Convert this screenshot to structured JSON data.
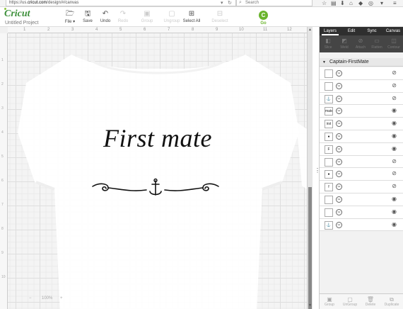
{
  "browser": {
    "url_prefix": "https://us.",
    "url_host": "cricut.com",
    "url_path": "/design/#/canvas",
    "search_placeholder": "Search"
  },
  "app": {
    "logo": "Cricut",
    "project_name": "Untitled Project",
    "accent": "#6ab42d",
    "go_label": "Go"
  },
  "toolbar": {
    "file": "File ▾",
    "save": "Save",
    "undo": "Undo",
    "redo": "Redo",
    "group": "Group",
    "ungroup": "Ungroup",
    "select_all": "Select All",
    "deselect": "Deselect"
  },
  "ruler": {
    "top": [
      "1",
      "2",
      "3",
      "4",
      "5",
      "6",
      "7",
      "8",
      "9",
      "10",
      "11",
      "12"
    ],
    "left": [
      "1",
      "2",
      "3",
      "4",
      "5",
      "6",
      "7",
      "8",
      "9",
      "10"
    ]
  },
  "design": {
    "title": "First mate"
  },
  "zoom": {
    "minus": "−",
    "value": "100%",
    "plus": "+"
  },
  "panel": {
    "tabs": [
      "Layers",
      "Edit",
      "Sync",
      "Canvas"
    ],
    "tools": [
      "Slice",
      "Weld",
      "Attach",
      "Flatten",
      "Contour"
    ],
    "group_name": "Captain-FirstMate",
    "layers": [
      {
        "thumb": "",
        "visible": "hidden"
      },
      {
        "thumb": "",
        "visible": "hidden"
      },
      {
        "thumb": "⚓",
        "visible": "hidden"
      },
      {
        "thumb": "mate",
        "visible": "visible"
      },
      {
        "thumb": "irst",
        "visible": "visible"
      },
      {
        "thumb": "●",
        "visible": "visible"
      },
      {
        "thumb": "F",
        "visible": "visible"
      },
      {
        "thumb": "",
        "visible": "hidden"
      },
      {
        "thumb": "●",
        "visible": "hidden"
      },
      {
        "thumb": "f",
        "visible": "hidden"
      },
      {
        "thumb": "",
        "visible": "visible"
      },
      {
        "thumb": "",
        "visible": "visible"
      },
      {
        "thumb": "⚓",
        "visible": "visible"
      }
    ],
    "bottom_tools": [
      "Group",
      "UnGroup",
      "Delete",
      "Duplicate"
    ]
  }
}
